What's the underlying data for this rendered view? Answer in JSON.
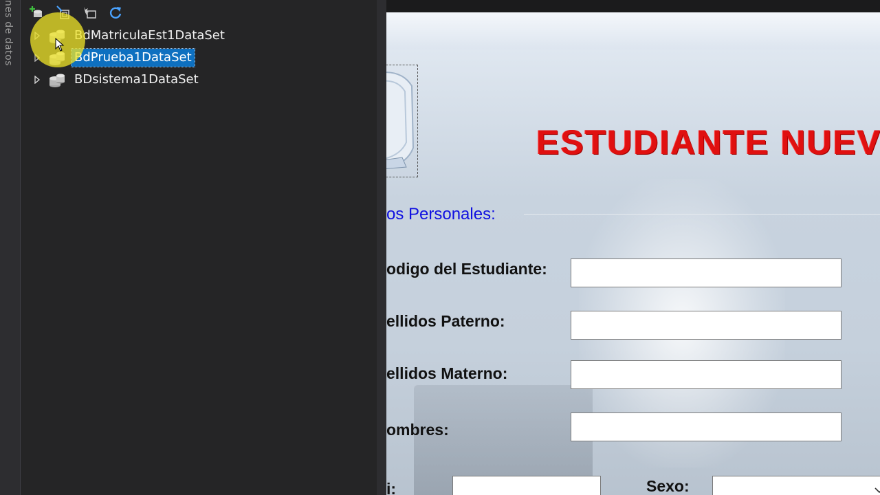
{
  "left_tab": {
    "label": "nes de datos"
  },
  "toolbar": {
    "buttons": [
      {
        "name": "add-data-source",
        "icon": "add-database-icon"
      },
      {
        "name": "edit-dataset-designer",
        "icon": "dataset-designer-icon"
      },
      {
        "name": "configure-dataset",
        "icon": "configure-wizard-icon"
      },
      {
        "name": "refresh",
        "icon": "refresh-icon"
      }
    ]
  },
  "tree": {
    "items": [
      {
        "label": "BdMatriculaEst1DataSet",
        "selected": false
      },
      {
        "label": "BdPrueba1DataSet",
        "selected": true
      },
      {
        "label": "BDsistema1DataSet",
        "selected": false
      }
    ]
  },
  "form": {
    "heading": "ESTUDIANTE NUEVO",
    "section_title": "os Personales:",
    "fields": [
      {
        "label": "odigo del Estudiante:"
      },
      {
        "label": "ellidos Paterno:"
      },
      {
        "label": "ellidos Materno:"
      },
      {
        "label": "ombres:"
      }
    ],
    "partial_label": "i:",
    "sexo_label": "Sexo:"
  },
  "colors": {
    "heading": "#e01010",
    "section_title": "#1010e0",
    "selection": "#0e70c0"
  }
}
